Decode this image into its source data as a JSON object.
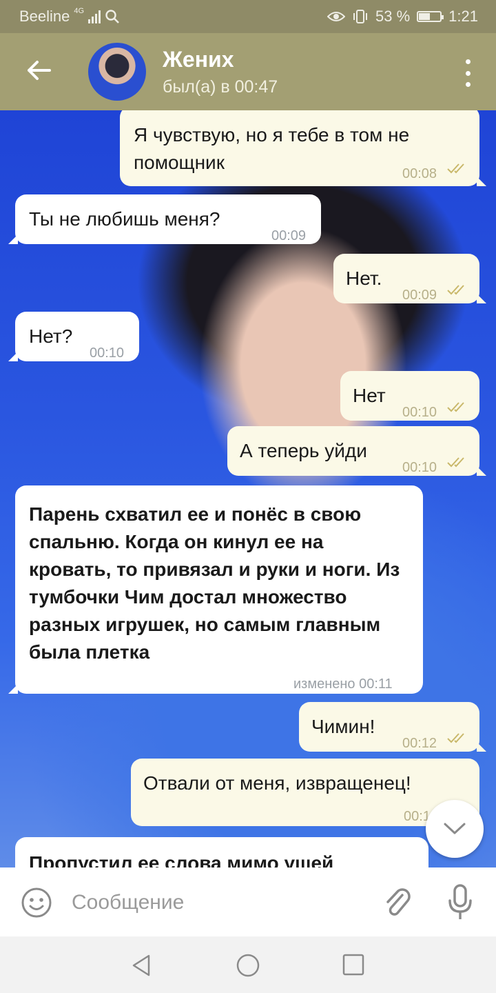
{
  "status_bar": {
    "carrier": "Beeline",
    "network": "4G",
    "battery_percent": "53 %",
    "battery_level": 0.53,
    "time": "1:21"
  },
  "header": {
    "title": "Жених",
    "subtitle": "был(а) в 00:47"
  },
  "messages": [
    {
      "dir": "out",
      "text": "Я чувствую, но я тебе в том не помощник",
      "time": "00:08",
      "read": true
    },
    {
      "dir": "in",
      "text": "Ты не любишь меня?",
      "time": "00:09"
    },
    {
      "dir": "out",
      "text": "Нет.",
      "time": "00:09",
      "read": true
    },
    {
      "dir": "in",
      "text": "Нет?",
      "time": "00:10"
    },
    {
      "dir": "out",
      "text": "Нет",
      "time": "00:10",
      "read": true
    },
    {
      "dir": "out",
      "text": "А теперь уйди",
      "time": "00:10",
      "read": true
    },
    {
      "dir": "in",
      "text": "Парень схватил ее и понёс в свою спальню. Когда он кинул ее на кровать, то привязал и руки и ноги. Из тумбочки Чим достал множество разных игрушек, но самым главным была плетка",
      "time": "изменено 00:11"
    },
    {
      "dir": "out",
      "text": "Чимин!",
      "time": "00:12",
      "read": true
    },
    {
      "dir": "out",
      "text": "Отвали от меня, извращенец!",
      "time": "00:1"
    },
    {
      "dir": "in",
      "text": "Пропустил ее слова мимо ушей"
    }
  ],
  "input": {
    "placeholder": "Сообщение"
  },
  "colors": {
    "status_bar": "#8f8b67",
    "header": "#a39f73",
    "outgoing_bubble": "#fbf9e7",
    "incoming_bubble": "#ffffff",
    "read_ticks": "#c9b86a"
  },
  "icons": {
    "back": "arrow-left-icon",
    "menu": "kebab-menu-icon",
    "scroll_down": "chevron-down-icon",
    "emoji": "smiley-icon",
    "attach": "paperclip-icon",
    "mic": "microphone-icon"
  }
}
